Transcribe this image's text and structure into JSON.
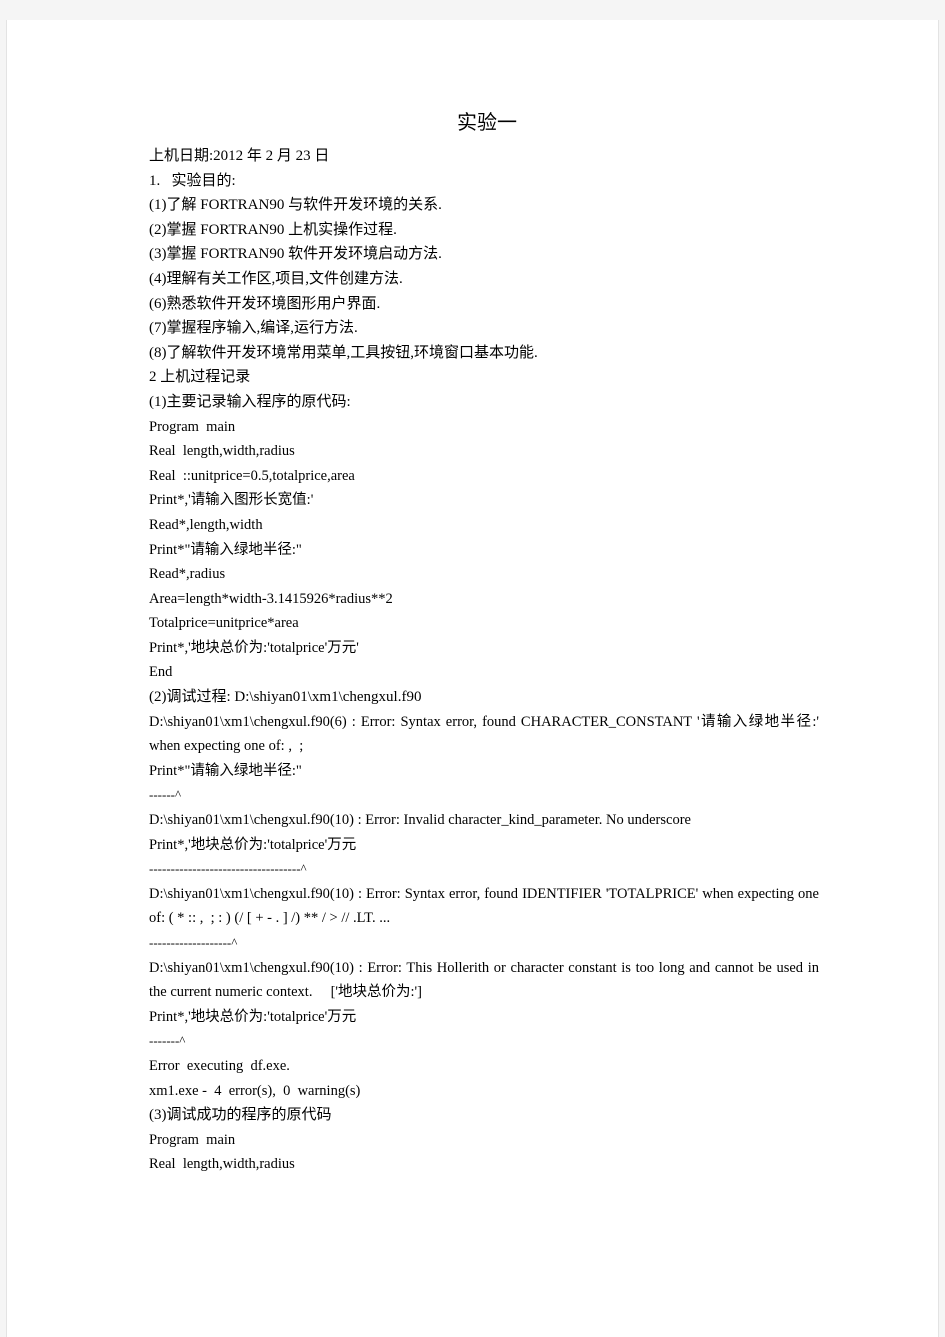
{
  "document": {
    "title": "实验一",
    "date_line": "上机日期:2012 年 2 月 23 日",
    "section1_heading": "1.   实验目的:",
    "objectives": [
      "(1)了解 FORTRAN90 与软件开发环境的关系.",
      "(2)掌握 FORTRAN90 上机实操作过程.",
      "(3)掌握 FORTRAN90 软件开发环境启动方法.",
      "(4)理解有关工作区,项目,文件创建方法.",
      "(6)熟悉软件开发环境图形用户界面.",
      "(7)掌握程序输入,编译,运行方法.",
      "(8)了解软件开发环境常用菜单,工具按钮,环境窗口基本功能."
    ],
    "section2_heading": "2 上机过程记录",
    "subsection1_heading": "(1)主要记录输入程序的原代码:",
    "source_code_1": [
      "Program  main",
      "Real  length,width,radius",
      "Real  ::unitprice=0.5,totalprice,area",
      "Print*,'请输入图形长宽值:'",
      "Read*,length,width",
      "Print*\"请输入绿地半径:\"",
      "Read*,radius",
      "Area=length*width-3.1415926*radius**2",
      "Totalprice=unitprice*area",
      "Print*,'地块总价为:'totalprice'万元'",
      "End"
    ],
    "subsection2_heading": "(2)调试过程: D:\\shiyan01\\xm1\\chengxul.f90",
    "debug_log": [
      {
        "kind": "error",
        "text": "D:\\shiyan01\\xm1\\chengxul.f90(6) : Error: Syntax error, found CHARACTER_CONSTANT '请输入绿地半径:' when expecting one of: ,  ;"
      },
      {
        "kind": "code",
        "text": "Print*\"请输入绿地半径:\""
      },
      {
        "kind": "marker",
        "text": "------^"
      },
      {
        "kind": "error",
        "text": "D:\\shiyan01\\xm1\\chengxul.f90(10) : Error: Invalid character_kind_parameter. No underscore"
      },
      {
        "kind": "code",
        "text": "Print*,'地块总价为:'totalprice'万元"
      },
      {
        "kind": "marker",
        "text": "-----------------------------------^"
      },
      {
        "kind": "error",
        "text": "D:\\shiyan01\\xm1\\chengxul.f90(10) : Error: Syntax error, found IDENTIFIER 'TOTALPRICE' when expecting one of: ( * :: ,  ; : ) (/ [ + - . ] /) ** / > // .LT. ..."
      },
      {
        "kind": "marker",
        "text": "-------------------^"
      },
      {
        "kind": "error",
        "text": "D:\\shiyan01\\xm1\\chengxul.f90(10) : Error: This Hollerith or character constant is too long and cannot be used in the current numeric context.     ['地块总价为:']"
      },
      {
        "kind": "code",
        "text": "Print*,'地块总价为:'totalprice'万元"
      },
      {
        "kind": "marker",
        "text": "-------^"
      },
      {
        "kind": "code",
        "text": "Error  executing  df.exe."
      },
      {
        "kind": "code",
        "text": "xm1.exe -  4  error(s),  0  warning(s)"
      }
    ],
    "subsection3_heading": "(3)调试成功的程序的原代码",
    "source_code_2": [
      "Program  main",
      "Real  length,width,radius"
    ]
  }
}
